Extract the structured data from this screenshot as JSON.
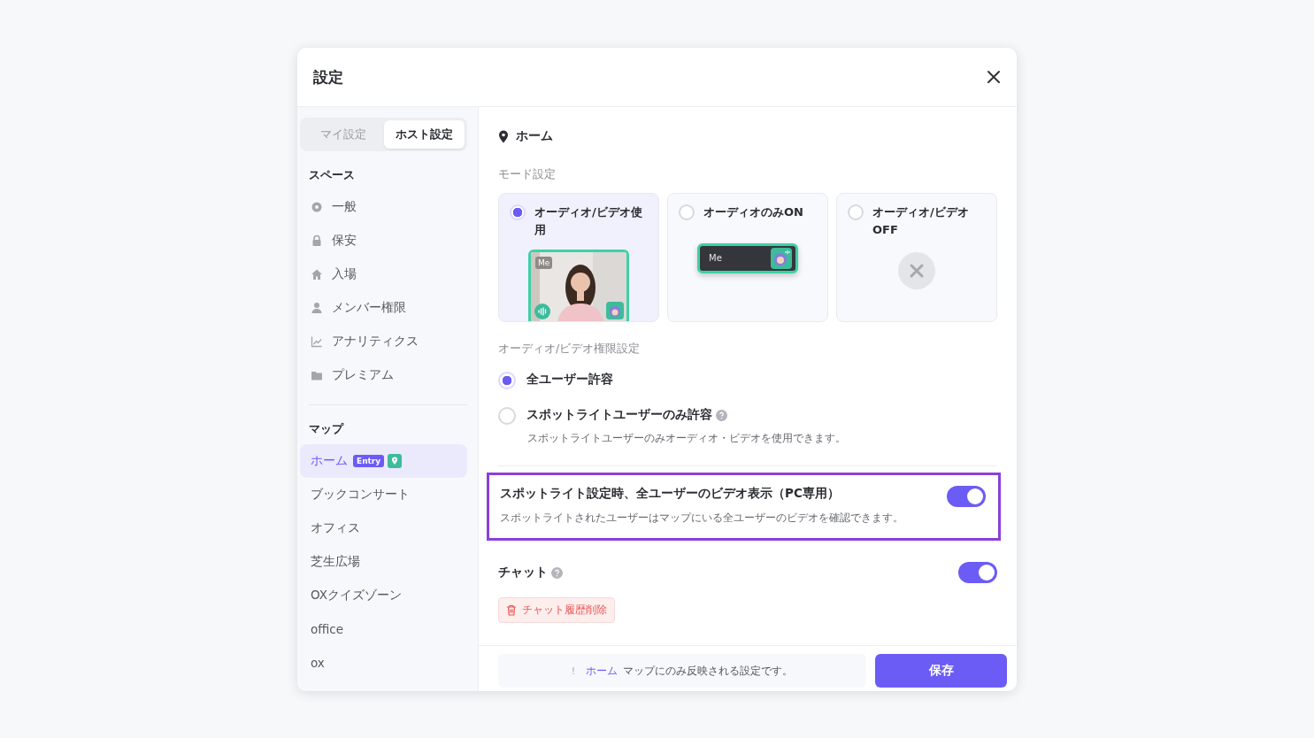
{
  "dialog": {
    "title": "設定"
  },
  "sidebar": {
    "tabs": [
      {
        "label": "マイ設定",
        "selected": false
      },
      {
        "label": "ホスト設定",
        "selected": true
      }
    ],
    "sections": [
      {
        "title": "スペース",
        "items": [
          {
            "label": "一般",
            "kind": "gear",
            "selected": false
          },
          {
            "label": "保安",
            "kind": "lock",
            "selected": false
          },
          {
            "label": "入場",
            "kind": "home",
            "selected": false
          },
          {
            "label": "メンバー権限",
            "kind": "person",
            "selected": false
          },
          {
            "label": "アナリティクス",
            "kind": "chart",
            "selected": false
          },
          {
            "label": "プレミアム",
            "kind": "folder",
            "selected": false
          }
        ]
      },
      {
        "title": "マップ",
        "items": [
          {
            "label": "ホーム",
            "selected": true,
            "badge": "Entry",
            "pin": true
          },
          {
            "label": "ブックコンサート",
            "selected": false
          },
          {
            "label": "オフィス",
            "selected": false
          },
          {
            "label": "芝生広場",
            "selected": false
          },
          {
            "label": "OXクイズゾーン",
            "selected": false
          },
          {
            "label": "office",
            "selected": false
          },
          {
            "label": "ox",
            "selected": false
          }
        ]
      }
    ]
  },
  "content": {
    "location": "ホーム",
    "mode": {
      "label": "モード設定",
      "options": [
        {
          "label": "オーディオ/ビデオ使用",
          "selected": true,
          "kind": "video",
          "me": "Me"
        },
        {
          "label": "オーディオのみON",
          "selected": false,
          "kind": "audio",
          "me": "Me"
        },
        {
          "label": "オーディオ/ビデオOFF",
          "selected": false,
          "kind": "off"
        }
      ]
    },
    "permission": {
      "label": "オーディオ/ビデオ権限設定",
      "options": [
        {
          "label": "全ユーザー許容",
          "selected": true,
          "help": false
        },
        {
          "label": "スポットライトユーザーのみ許容",
          "selected": false,
          "help": true,
          "description": "スポットライトユーザーのみオーディオ・ビデオを使用できます。"
        }
      ]
    },
    "spotlight": {
      "title": "スポットライト設定時、全ユーザーのビデオ表示（PC専用）",
      "description": "スポットライトされたユーザーはマップにいる全ユーザーのビデオを確認できます。",
      "on": true,
      "highlighted": true
    },
    "chat": {
      "title": "チャット",
      "help": true,
      "on": true,
      "clear_button": "チャット履歴削除"
    },
    "footer": {
      "notice_icon": "!",
      "notice_map": "ホーム",
      "notice_text": "マップにのみ反映される設定です。",
      "save": "保存"
    }
  }
}
